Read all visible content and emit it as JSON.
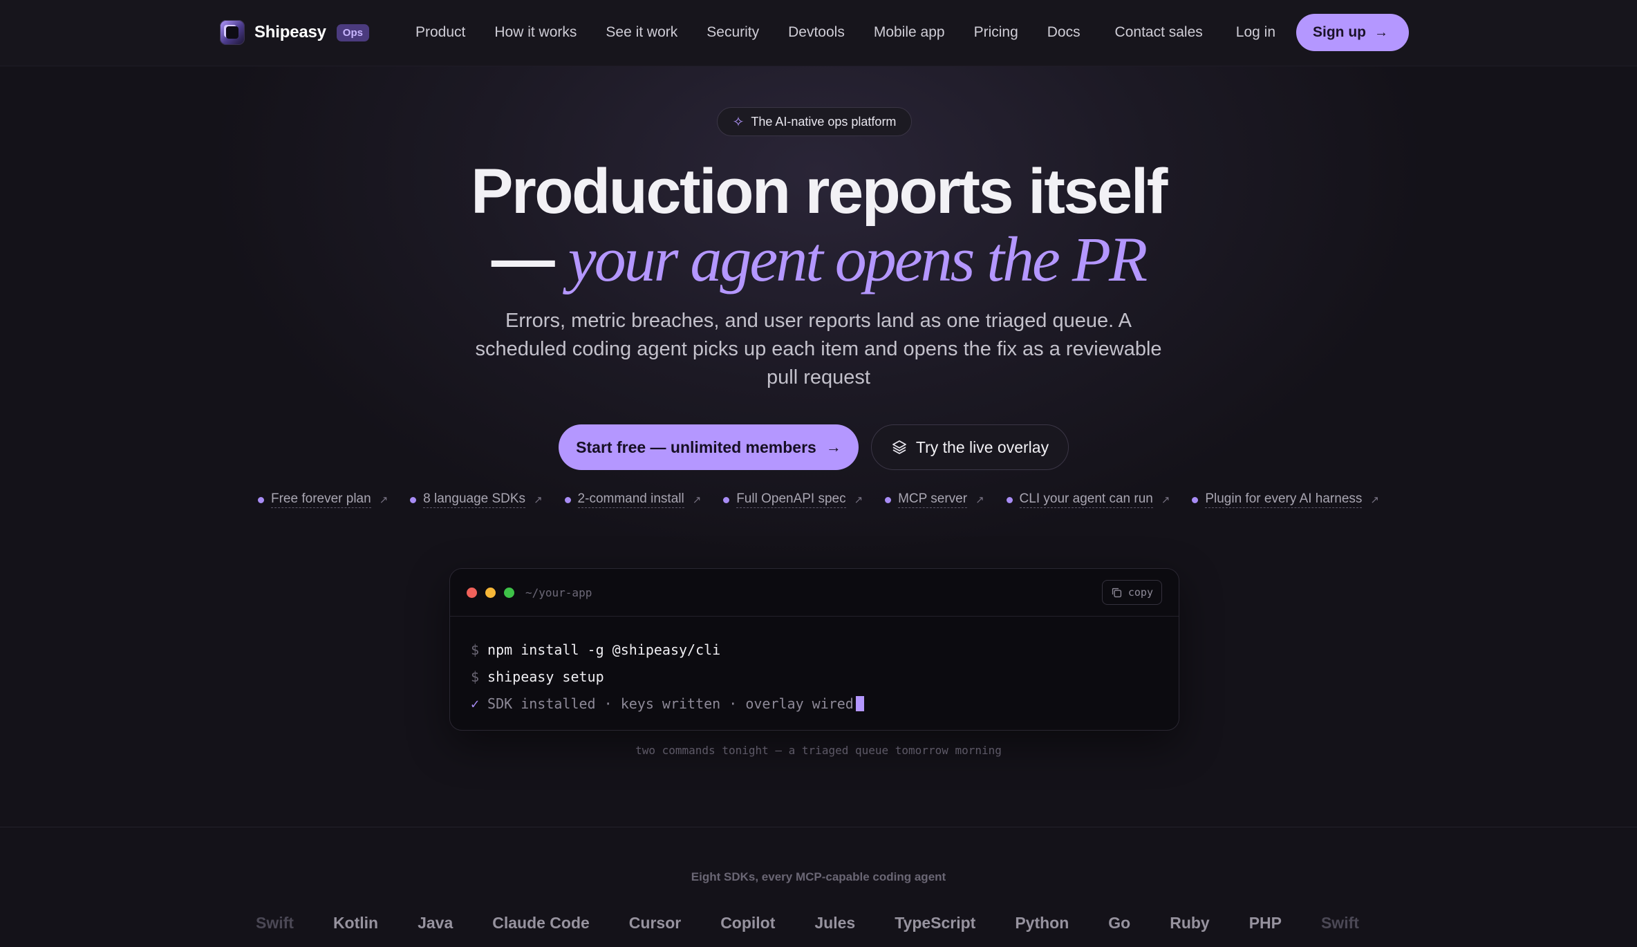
{
  "nav": {
    "brand": "Shipeasy",
    "badge": "Ops",
    "links": [
      "Product",
      "How it works",
      "See it work",
      "Security",
      "Devtools",
      "Mobile app",
      "Pricing",
      "Docs"
    ],
    "contact": "Contact sales",
    "login": "Log in",
    "signup": "Sign up"
  },
  "hero": {
    "pill": "The AI-native ops platform",
    "title_line1": "Production reports itself",
    "title_dash": "—",
    "title_italic": "your agent opens the PR",
    "subtitle": "Errors, metric breaches, and user reports land as one triaged queue. A scheduled coding agent picks up each item and opens the fix as a reviewable pull request",
    "cta_primary": "Start free — unlimited members",
    "cta_secondary": "Try the live overlay"
  },
  "features": [
    "Free forever plan",
    "8 language SDKs",
    "2-command install",
    "Full OpenAPI spec",
    "MCP server",
    "CLI your agent can run",
    "Plugin for every AI harness"
  ],
  "terminal": {
    "path": "~/your-app",
    "copy": "copy",
    "prompt": "$",
    "check": "✓",
    "cmd1": "npm install -g @shipeasy/cli",
    "cmd2": "shipeasy setup",
    "result": "SDK installed · keys written · overlay wired",
    "caption": "two commands tonight — a triaged queue tomorrow morning"
  },
  "sdks": {
    "title": "Eight SDKs, every MCP-capable coding agent",
    "items": [
      "Swift",
      "Kotlin",
      "Java",
      "Claude Code",
      "Cursor",
      "Copilot",
      "Jules",
      "TypeScript",
      "Python",
      "Go",
      "Ruby",
      "PHP",
      "Swift"
    ]
  },
  "colors": {
    "accent": "#b497ff",
    "background": "#141219",
    "terminal_bg": "#0c0b10"
  }
}
